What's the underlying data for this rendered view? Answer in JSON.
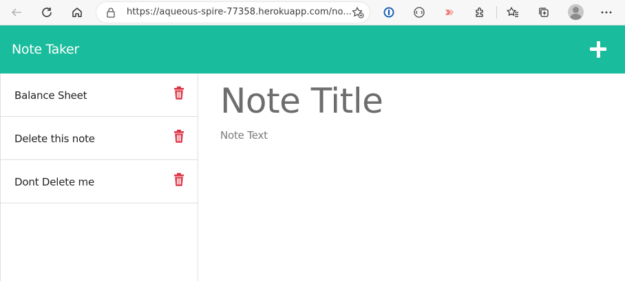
{
  "browser": {
    "url": "https://aqueous-spire-77358.herokuapp.com/no...",
    "icons": [
      "back-icon",
      "refresh-icon",
      "home-icon",
      "lock-icon",
      "add-favorite-icon",
      "password-manager-icon",
      "reader-icon",
      "extension-red-icon",
      "extensions-icon",
      "favorites-icon",
      "collections-icon",
      "profile-icon",
      "more-icon"
    ]
  },
  "app": {
    "brand": "Note Taker",
    "accent_color": "#19bc9c",
    "delete_color": "#dc3545"
  },
  "notes": [
    {
      "title": "Balance Sheet"
    },
    {
      "title": "Delete this note"
    },
    {
      "title": "Dont Delete me"
    }
  ],
  "editor": {
    "title_placeholder": "Note Title",
    "text_placeholder": "Note Text"
  }
}
